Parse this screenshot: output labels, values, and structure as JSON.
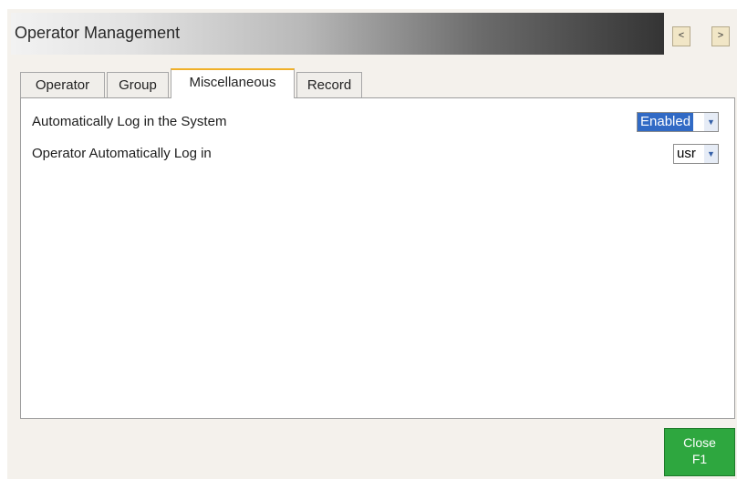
{
  "window": {
    "title": "Operator Management"
  },
  "navigation": {
    "prev_label": "<",
    "next_label": ">"
  },
  "tabs": [
    {
      "label": "Operator",
      "active": false
    },
    {
      "label": "Group",
      "active": false
    },
    {
      "label": "Miscellaneous",
      "active": true
    },
    {
      "label": "Record",
      "active": false
    }
  ],
  "settings": [
    {
      "label": "Automatically Log in the System",
      "value": "Enabled"
    },
    {
      "label": "Operator Automatically Log in",
      "value": "usr"
    }
  ],
  "footer": {
    "close_label": "Close",
    "close_shortcut": "F1"
  },
  "icons": {
    "dropdown": "chevron-down-icon"
  },
  "colors": {
    "active_tab_accent": "#f0b028",
    "selection_highlight": "#316ac5",
    "close_button": "#2ea73f",
    "nav_button": "#f1e6c6"
  }
}
